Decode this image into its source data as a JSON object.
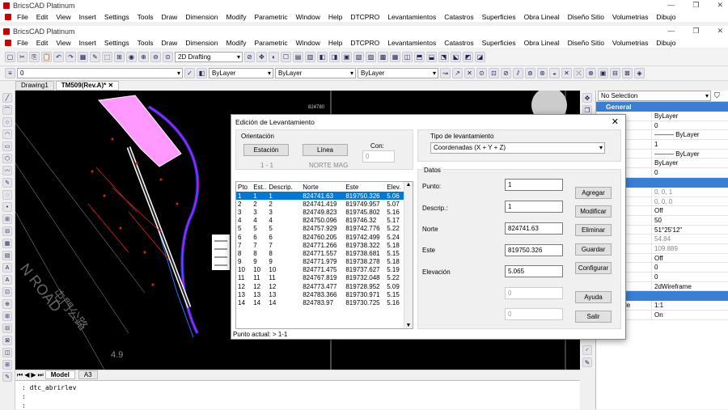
{
  "app": {
    "title": "BricsCAD Platinum"
  },
  "menus": [
    "File",
    "Edit",
    "View",
    "Insert",
    "Settings",
    "Tools",
    "Draw",
    "Dimension",
    "Modify",
    "Parametric",
    "Window",
    "Help",
    "DTCPRO",
    "Levantamientos",
    "Catastros",
    "Superficies",
    "Obra Lineal",
    "Diseño Sitio",
    "Volumetrias",
    "Dibujo"
  ],
  "toolbar": {
    "workspace": "2D Drafting",
    "layer": "0",
    "color": "ByLayer",
    "linetype": "ByLayer",
    "lineweight": "ByLayer"
  },
  "tabs": {
    "drawing1": "Drawing1",
    "active": "TM509(Rev.A)*",
    "close": "✕"
  },
  "canvas": {
    "road_label": "N ROAD",
    "chinese_label": "屯門公路",
    "scale_label": "4.9",
    "number_label": "824780"
  },
  "model": {
    "model_tab": "Model",
    "a3_tab": "A3"
  },
  "command": {
    "line1": ": dtc_abrirlev",
    "line2": ":",
    "line3": ":"
  },
  "props": {
    "selection": "No Selection",
    "section": "General",
    "rows": [
      {
        "k": "",
        "v": "ByLayer"
      },
      {
        "k": "",
        "v": "0"
      },
      {
        "k": "e",
        "v": "——— ByLayer"
      },
      {
        "k": "e scale",
        "v": "1"
      },
      {
        "k": "ight",
        "v": "——— ByLayer"
      },
      {
        "k": "arency",
        "v": "ByLayer"
      },
      {
        "k": "ction",
        "v": "0"
      }
    ],
    "rows2": [
      {
        "k": "a",
        "v": "0, 0, 1",
        "gray": true
      },
      {
        "k": "",
        "v": "0, 0, 0",
        "gray": true
      },
      {
        "k": "ctive",
        "v": "Off"
      },
      {
        "k": "ngth",
        "v": "50"
      },
      {
        "k": "f view",
        "v": "51°25'12\""
      },
      {
        "k": "",
        "v": "54.84",
        "gray": true
      },
      {
        "k": "",
        "v": "109.889",
        "gray": true
      },
      {
        "k": "g",
        "v": "Off"
      },
      {
        "k": "lane",
        "v": "0"
      },
      {
        "k": "ane",
        "v": "0"
      },
      {
        "k": "style",
        "v": "2dWireframe"
      }
    ],
    "rows3": [
      {
        "k": "ation scale",
        "v": "1:1"
      },
      {
        "k": "t lighting",
        "v": "On"
      }
    ]
  },
  "dialog": {
    "title": "Edición de Levantamiento",
    "close": "✕",
    "orientacion": "Orientación",
    "estacion_btn": "Estación",
    "linea_btn": "Línea",
    "con_label": "Con:",
    "con_value": "0",
    "sub1": "1 - 1",
    "sub2": "NORTE MAG",
    "tipo_label": "Tipo de levantamiento",
    "tipo_value": "Coordenadas (X + Y + Z)",
    "columns": [
      "Pto",
      "Est..",
      "Descrip.",
      "Norte",
      "Este",
      "Elev."
    ],
    "rows": [
      [
        "1",
        "1",
        "1",
        "824741.63",
        "819750.326",
        "5.06"
      ],
      [
        "2",
        "2",
        "2",
        "824741.419",
        "819749.957",
        "5.07"
      ],
      [
        "3",
        "3",
        "3",
        "824749.823",
        "819745.802",
        "5.16"
      ],
      [
        "4",
        "4",
        "4",
        "824750.096",
        "819746.32",
        "5.17"
      ],
      [
        "5",
        "5",
        "5",
        "824757.929",
        "819742.776",
        "5.22"
      ],
      [
        "6",
        "6",
        "6",
        "824760.205",
        "819742.499",
        "5.24"
      ],
      [
        "7",
        "7",
        "7",
        "824771.266",
        "819738.322",
        "5.18"
      ],
      [
        "8",
        "8",
        "8",
        "824771.557",
        "819738.681",
        "5.15"
      ],
      [
        "9",
        "9",
        "9",
        "824771.979",
        "819738.278",
        "5.18"
      ],
      [
        "10",
        "10",
        "10",
        "824771.475",
        "819737.627",
        "5.19"
      ],
      [
        "11",
        "11",
        "11",
        "824767.819",
        "819732.048",
        "5.22"
      ],
      [
        "12",
        "12",
        "12",
        "824773.477",
        "819728.952",
        "5.09"
      ],
      [
        "13",
        "13",
        "13",
        "824783.366",
        "819730.971",
        "5.15"
      ],
      [
        "14",
        "14",
        "14",
        "824783.97",
        "819730.725",
        "5.16"
      ]
    ],
    "datos": "Datos",
    "punto_label": "Punto:",
    "punto_value": "1",
    "descrip_label": "Descrip.:",
    "descrip_value": "1",
    "norte_label": "Norte",
    "norte_value": "824741.63",
    "este_label": "Este",
    "este_value": "819750.326",
    "elev_label": "Elevación",
    "elev_value": "5.065",
    "extra1": "0",
    "extra2": "0",
    "agregar": "Agregar",
    "modificar": "Modificar",
    "eliminar": "Eliminar",
    "guardar": "Guardar",
    "configurar": "Configurar",
    "ayuda": "Ayuda",
    "salir": "Salir",
    "status": "Punto actual: > 1-1"
  },
  "colors": {
    "accent": "#3a7fd5",
    "selection": "#0078d7",
    "pink": "#ff99ff",
    "magenta": "#e61ee6"
  }
}
